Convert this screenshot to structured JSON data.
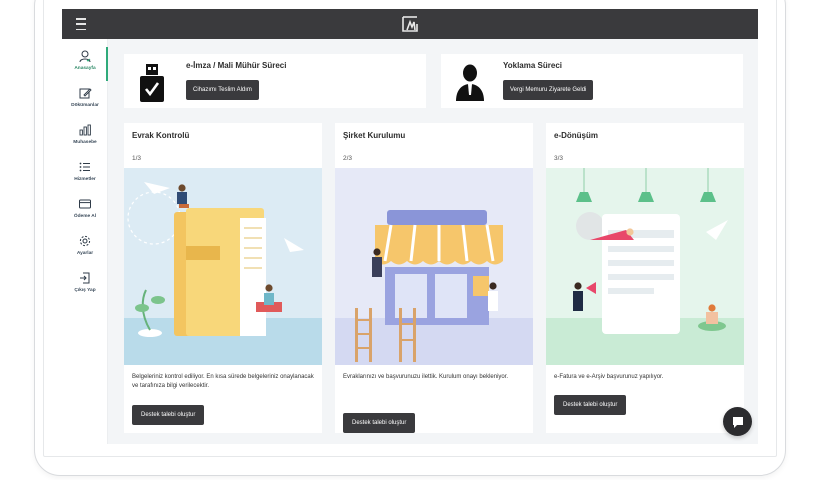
{
  "sidebar": {
    "items": [
      {
        "label": "Anasayfa",
        "icon": "user-icon",
        "active": true
      },
      {
        "label": "Dökümanlar",
        "icon": "edit-icon"
      },
      {
        "label": "Muhasebe",
        "icon": "bar-chart-icon"
      },
      {
        "label": "Hizmetler",
        "icon": "list-icon"
      },
      {
        "label": "Ödeme Al",
        "icon": "credit-card-icon"
      },
      {
        "label": "Ayarlar",
        "icon": "gear-icon"
      },
      {
        "label": "Çıkış Yap",
        "icon": "logout-icon"
      }
    ]
  },
  "cards": {
    "esign": {
      "title": "e-İmza / Mali Mühür Süreci",
      "button": "Cihazımı Teslim Aldım",
      "icon": "usb-token-icon"
    },
    "inspection": {
      "title": "Yoklama Süreci",
      "button": "Vergi Memuru Ziyarete Geldi",
      "icon": "person-silhouette-icon"
    }
  },
  "steps": [
    {
      "title": "Evrak Kontrolü",
      "num": "1/3",
      "desc": "Belgeleriniz kontrol ediliyor. En kısa sürede belgeleriniz onaylanacak ve tarafınıza bilgi verilecektir.",
      "button": "Destek talebi oluştur"
    },
    {
      "title": "Şirket Kurulumu",
      "num": "2/3",
      "desc": "Evraklarınızı ve başvurunuzu ilettik. Kurulum onayı bekleniyor.",
      "button": "Destek talebi oluştur"
    },
    {
      "title": "e-Dönüşüm",
      "num": "3/3",
      "desc": "e-Fatura ve e-Arşiv başvurunuz yapılıyor.",
      "button": "Destek talebi oluştur"
    }
  ],
  "colors": {
    "topbar": "#3a3a3d",
    "accent": "#2faa7a",
    "button": "#3a3a3d"
  }
}
